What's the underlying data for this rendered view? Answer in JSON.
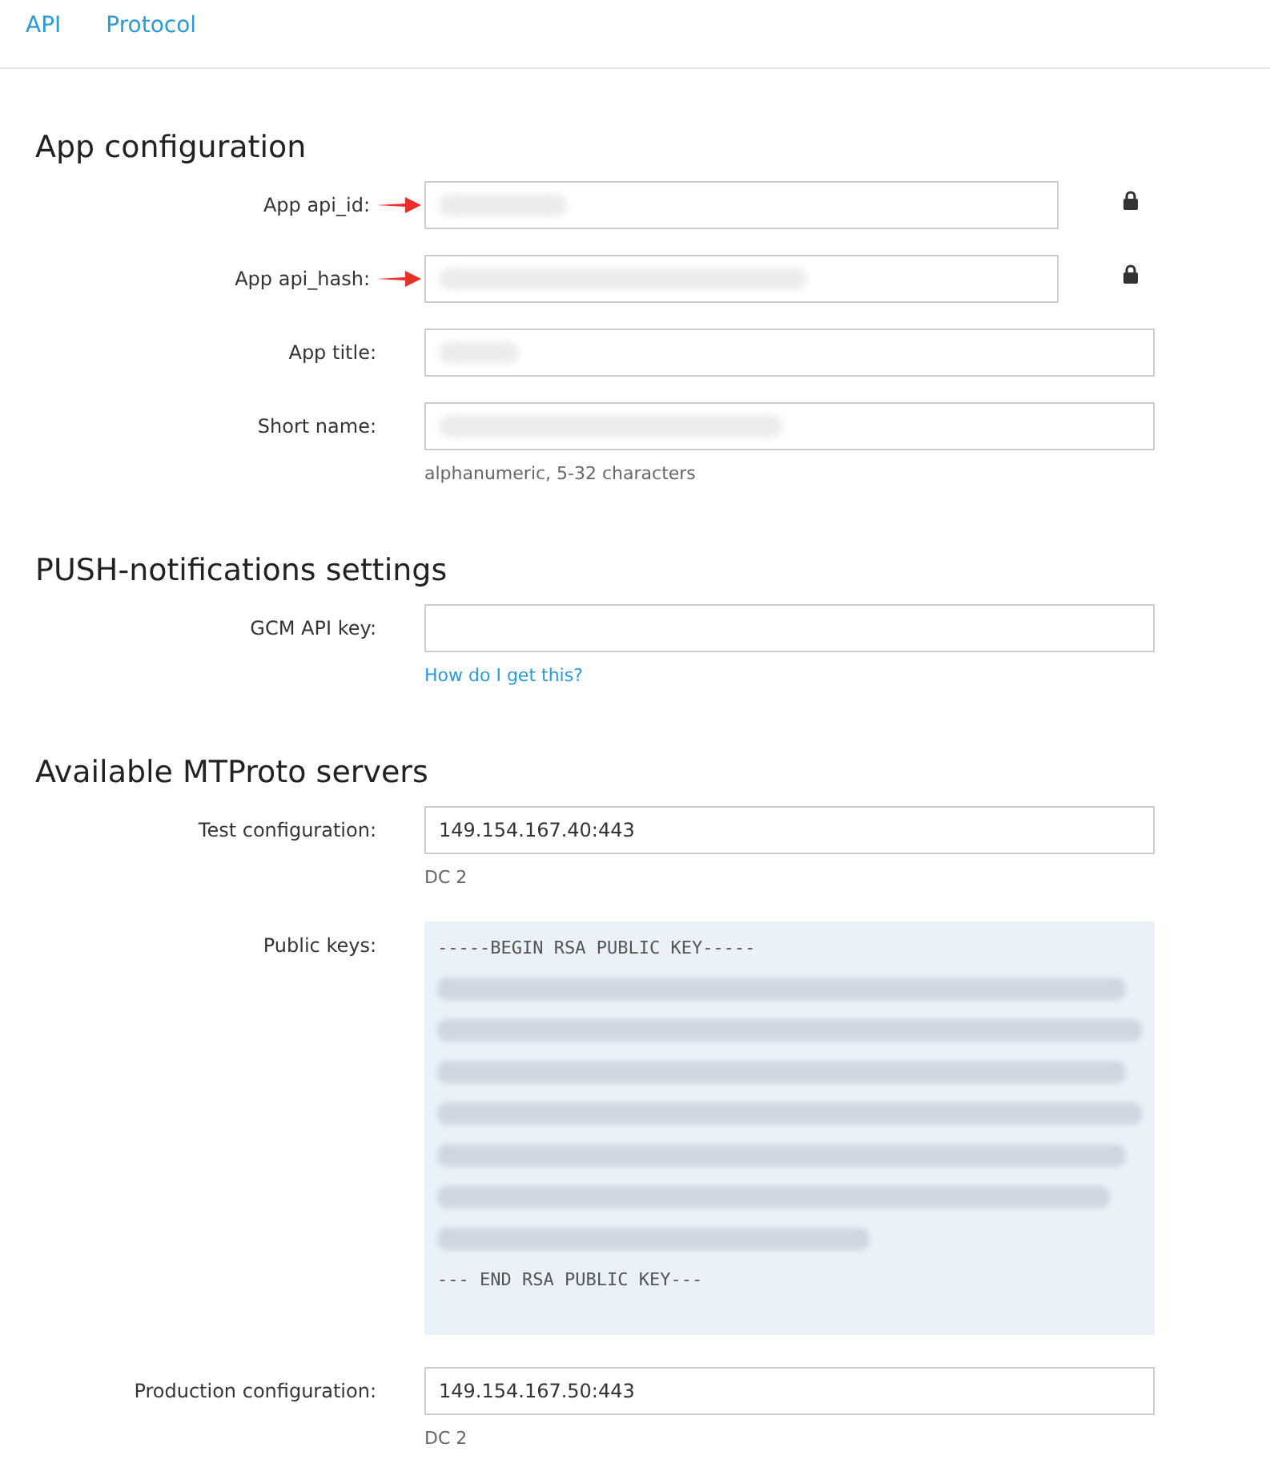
{
  "nav": [
    {
      "label": "API"
    },
    {
      "label": "Protocol"
    }
  ],
  "sections": [
    {
      "title": "App configuration",
      "fields": [
        {
          "label": "App api_id:",
          "kind": "redacted",
          "locked": true,
          "annotated": true
        },
        {
          "label": "App api_hash:",
          "kind": "redacted",
          "locked": true,
          "annotated": true
        },
        {
          "label": "App title:",
          "kind": "redacted",
          "locked": false,
          "annotated": false
        },
        {
          "label": "Short name:",
          "kind": "redacted",
          "locked": false,
          "annotated": false,
          "hint": "alphanumeric, 5-32 characters"
        }
      ]
    },
    {
      "title": "PUSH-notifications settings",
      "fields": [
        {
          "label": "GCM API key:",
          "kind": "text",
          "locked": false,
          "annotated": false,
          "link": "How do I get this?"
        }
      ]
    },
    {
      "title": "Available MTProto servers",
      "fields": [
        {
          "label": "Test configuration:",
          "kind": "text",
          "value": "149.154.167.40:443",
          "locked": false,
          "annotated": false,
          "hint": "DC 2"
        },
        {
          "label": "Public keys:",
          "kind": "key",
          "first_line": "-----BEGIN RSA PUBLIC KEY-----",
          "last_line": "---  END RSA PUBLIC KEY---"
        },
        {
          "label": "Production configuration:",
          "kind": "text",
          "value": "149.154.167.50:443",
          "locked": false,
          "annotated": false,
          "hint": "DC 2"
        }
      ]
    }
  ]
}
